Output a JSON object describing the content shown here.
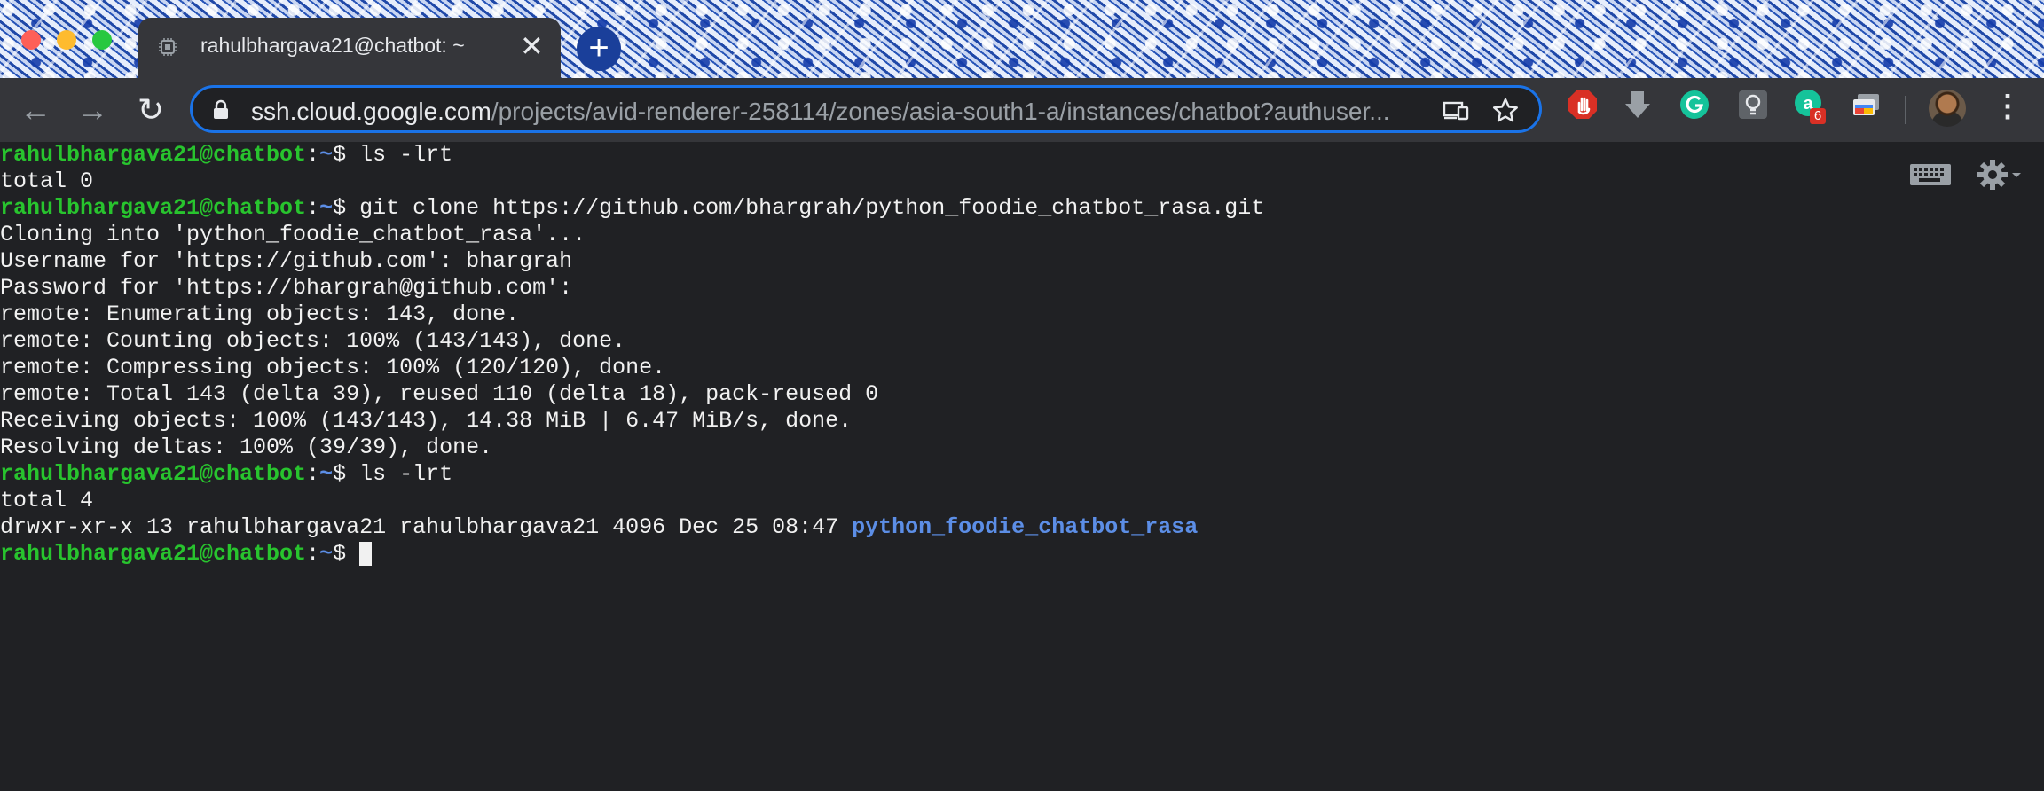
{
  "window": {
    "traffic_lights": {
      "close": "#fe5f57",
      "minimize": "#febb2e",
      "zoom": "#28c840"
    }
  },
  "tab": {
    "title": "rahulbhargava21@chatbot: ~",
    "close_glyph": "✕",
    "icon": "chip-icon"
  },
  "new_tab": {
    "glyph": "+"
  },
  "toolbar": {
    "back_glyph": "←",
    "forward_glyph": "→",
    "reload_glyph": "↻",
    "url_host": "ssh.cloud.google.com",
    "url_path": "/projects/avid-renderer-258114/zones/asia-south1-a/instances/chatbot?authuser..."
  },
  "extensions": {
    "badge_count": "6"
  },
  "terminal": {
    "prompt_user": "rahulbhargava21@chatbot",
    "prompt_sep": ":",
    "prompt_path": "~",
    "prompt_symbol": "$",
    "lines": [
      {
        "type": "cmd",
        "text": " ls -lrt"
      },
      {
        "type": "out",
        "text": "total 0"
      },
      {
        "type": "cmd",
        "text": " git clone https://github.com/bhargrah/python_foodie_chatbot_rasa.git"
      },
      {
        "type": "out",
        "text": "Cloning into 'python_foodie_chatbot_rasa'..."
      },
      {
        "type": "out",
        "text": "Username for 'https://github.com': bhargrah"
      },
      {
        "type": "out",
        "text": "Password for 'https://bhargrah@github.com':"
      },
      {
        "type": "out",
        "text": "remote: Enumerating objects: 143, done."
      },
      {
        "type": "out",
        "text": "remote: Counting objects: 100% (143/143), done."
      },
      {
        "type": "out",
        "text": "remote: Compressing objects: 100% (120/120), done."
      },
      {
        "type": "out",
        "text": "remote: Total 143 (delta 39), reused 110 (delta 18), pack-reused 0"
      },
      {
        "type": "out",
        "text": "Receiving objects: 100% (143/143), 14.38 MiB | 6.47 MiB/s, done."
      },
      {
        "type": "out",
        "text": "Resolving deltas: 100% (39/39), done."
      },
      {
        "type": "cmd",
        "text": " ls -lrt"
      },
      {
        "type": "out",
        "text": "total 4"
      },
      {
        "type": "ls",
        "text": "drwxr-xr-x 13 rahulbhargava21 rahulbhargava21 4096 Dec 25 08:47 ",
        "dir": "python_foodie_chatbot_rasa"
      },
      {
        "type": "cursor",
        "text": " "
      }
    ]
  },
  "colors": {
    "prompt_green": "#28c42e",
    "dir_blue": "#5c8ee6",
    "terminal_bg": "#202124",
    "omnibox_border": "#1a73e8"
  }
}
